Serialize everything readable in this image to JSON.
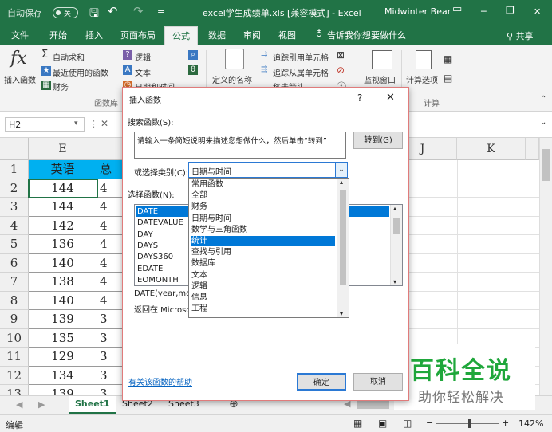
{
  "title_bar": {
    "autosave_label": "自动保存",
    "autosave_state": "关",
    "quick_access_more": "=",
    "doc_title": "excel学生成绩单.xls  [兼容模式]  -  Excel",
    "user": "Midwinter Bear",
    "minimize": "─",
    "restore": "❐",
    "close": "✕"
  },
  "ribbon_tabs": [
    "文件",
    "开始",
    "插入",
    "页面布局",
    "公式",
    "数据",
    "审阅",
    "视图"
  ],
  "active_tab": "公式",
  "tell_me": "告诉我你想要做什么",
  "share": "共享",
  "ribbon": {
    "insert_function": "插入函数",
    "autosum": "自动求和",
    "recent": "最近使用的函数",
    "financial": "财务",
    "logical": "逻辑",
    "text": "文本",
    "datetime": "日期和时间",
    "group_library": "函数库",
    "define_name": "定义的名称",
    "trace_precedents": "追踪引用单元格",
    "trace_dependents": "追踪从属单元格",
    "remove_arrows": "移去箭头",
    "watch_window": "监视窗口",
    "calc_options": "计算选项",
    "group_calc": "计算"
  },
  "formula_bar": {
    "name_box": "H2",
    "cancel": "✕"
  },
  "columns": [
    {
      "id": "E",
      "label": "E"
    },
    {
      "id": "F",
      "label": ""
    },
    {
      "id": "J",
      "label": "J"
    },
    {
      "id": "K",
      "label": "K"
    }
  ],
  "rows": [
    {
      "num": "1",
      "E": "英语",
      "F": "总"
    },
    {
      "num": "2",
      "E": "144",
      "F": "4"
    },
    {
      "num": "3",
      "E": "144",
      "F": "4"
    },
    {
      "num": "4",
      "E": "142",
      "F": "4"
    },
    {
      "num": "5",
      "E": "136",
      "F": "4"
    },
    {
      "num": "6",
      "E": "140",
      "F": "4"
    },
    {
      "num": "7",
      "E": "138",
      "F": "4"
    },
    {
      "num": "8",
      "E": "140",
      "F": "4"
    },
    {
      "num": "9",
      "E": "139",
      "F": "3"
    },
    {
      "num": "10",
      "E": "135",
      "F": "3"
    },
    {
      "num": "11",
      "E": "129",
      "F": "3"
    },
    {
      "num": "12",
      "E": "134",
      "F": "3"
    },
    {
      "num": "13",
      "E": "139",
      "F": "3"
    }
  ],
  "sheets": [
    "Sheet1",
    "Sheet2",
    "Sheet3"
  ],
  "active_sheet": "Sheet1",
  "status": {
    "mode": "编辑",
    "zoom": "142%",
    "minus": "−",
    "plus": "+"
  },
  "dialog": {
    "title": "插入函数",
    "help": "?",
    "close": "✕",
    "search_label": "搜索函数(S):",
    "search_placeholder": "请输入一条简短说明来描述您想做什么，然后单击“转到”",
    "go_button": "转到(G)",
    "category_label": "或选择类别(C):",
    "category_value": "日期与时间",
    "category_options": [
      "常用函数",
      "全部",
      "财务",
      "日期与时间",
      "数学与三角函数",
      "统计",
      "查找与引用",
      "数据库",
      "文本",
      "逻辑",
      "信息",
      "工程"
    ],
    "category_highlighted": "统计",
    "function_label": "选择函数(N):",
    "functions": [
      "DATE",
      "DATEVALUE",
      "DAY",
      "DAYS",
      "DAYS360",
      "EDATE",
      "EOMONTH"
    ],
    "selected_function": "DATE",
    "signature": "DATE(year,mo",
    "description": "返回在 Microso",
    "help_link": "有关该函数的帮助",
    "ok": "确定",
    "cancel": "取消"
  },
  "watermark": {
    "title": "百科全说",
    "subtitle": "助你轻松解决"
  },
  "colors": {
    "excel_green": "#217346",
    "header_blue": "#00b0f0",
    "selection_blue": "#0078d7",
    "watermark_green": "#1fa73b"
  }
}
